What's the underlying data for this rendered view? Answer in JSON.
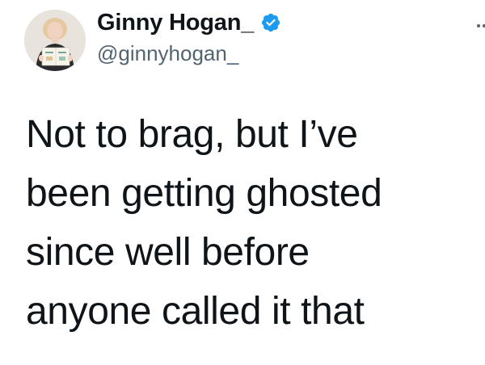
{
  "author": {
    "display_name": "Ginny Hogan_",
    "handle": "@ginnyhogan_",
    "verified": true,
    "verified_icon": "verified-badge-icon",
    "avatar_icon": "profile-photo"
  },
  "menu": {
    "icon": "more-options-icon"
  },
  "tweet": {
    "lines": [
      "Not to brag, but I’ve",
      "been getting ghosted",
      "since well before",
      "anyone called it that"
    ]
  },
  "colors": {
    "text": "#0f1419",
    "secondary": "#536471",
    "verified": "#1d9bf0"
  }
}
